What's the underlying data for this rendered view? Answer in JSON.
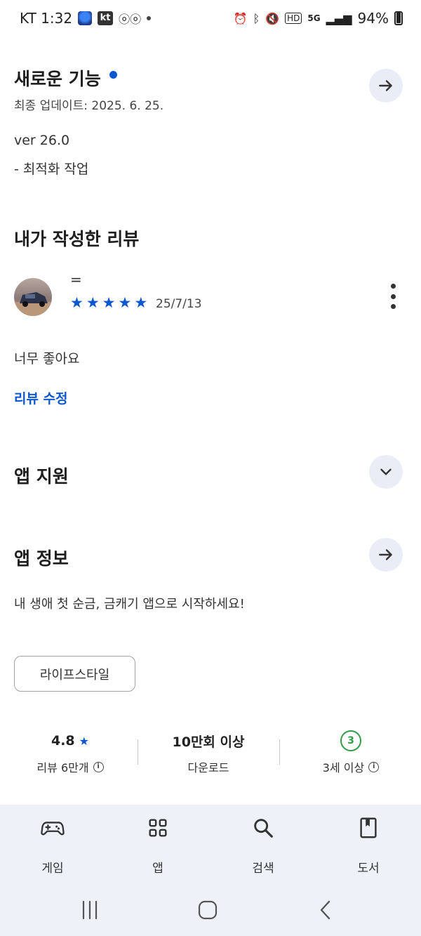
{
  "status_bar": {
    "carrier_time": "KT 1:32",
    "kt_badge": "kt",
    "battery": "94%"
  },
  "whats_new": {
    "title": "새로운 기능",
    "updated": "최종 업데이트: 2025. 6. 25.",
    "version": "ver 26.0",
    "note": "- 최적화 작업"
  },
  "my_review": {
    "title": "내가 작성한 리뷰",
    "reviewer_name": "=",
    "rating": 5,
    "date": "25/7/13",
    "text": "너무 좋아요",
    "edit_label": "리뷰 수정"
  },
  "app_support": {
    "title": "앱 지원"
  },
  "app_info": {
    "title": "앱 정보",
    "description": "내 생애 첫 순금, 금캐기 앱으로 시작하세요!",
    "category_chip": "라이프스타일"
  },
  "stats": {
    "rating_value": "4.8",
    "rating_label": "리뷰 6만개",
    "downloads_value": "10만회 이상",
    "downloads_label": "다운로드",
    "age_value": "3",
    "age_label": "3세 이상"
  },
  "bottom_nav": {
    "games": "게임",
    "apps": "앱",
    "search": "검색",
    "books": "도서"
  },
  "colors": {
    "accent": "#0b57d0",
    "nav_bg": "#eef2f8",
    "button_bg": "#e9eef6",
    "age_green": "#2e9e49"
  }
}
